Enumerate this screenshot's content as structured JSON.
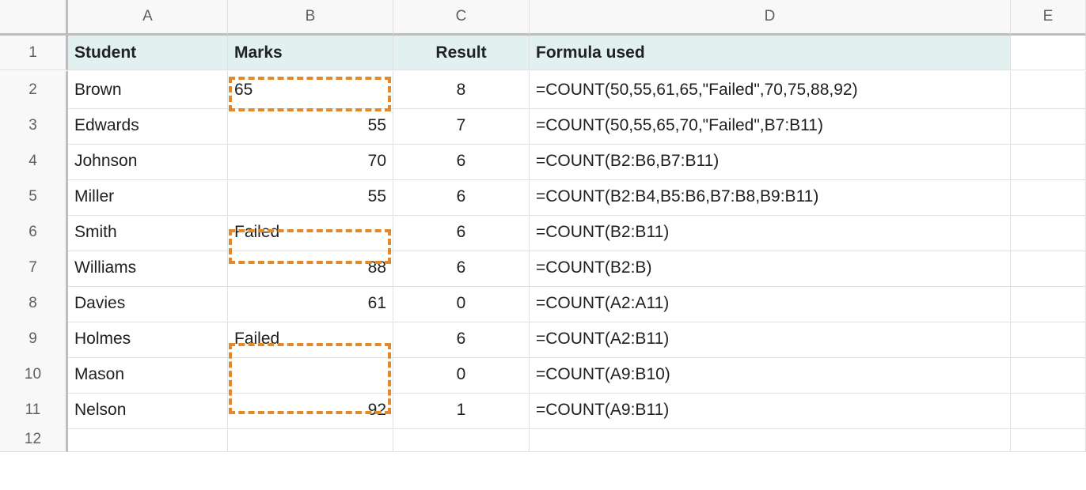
{
  "columns": [
    "A",
    "B",
    "C",
    "D",
    "E"
  ],
  "rows": [
    "1",
    "2",
    "3",
    "4",
    "5",
    "6",
    "7",
    "8",
    "9",
    "10",
    "11",
    "12"
  ],
  "headers": {
    "A": "Student",
    "B": "Marks",
    "C": "Result",
    "D": "Formula used"
  },
  "data": [
    {
      "student": "Brown",
      "marks": "65",
      "result": "8",
      "formula": "=COUNT(50,55,61,65,\"Failed\",70,75,88,92)"
    },
    {
      "student": "Edwards",
      "marks": "55",
      "result": "7",
      "formula": "=COUNT(50,55,65,70,\"Failed\",B7:B11)"
    },
    {
      "student": "Johnson",
      "marks": "70",
      "result": "6",
      "formula": "=COUNT(B2:B6,B7:B11)"
    },
    {
      "student": "Miller",
      "marks": "55",
      "result": "6",
      "formula": "=COUNT(B2:B4,B5:B6,B7:B8,B9:B11)"
    },
    {
      "student": "Smith",
      "marks": "Failed",
      "result": "6",
      "formula": "=COUNT(B2:B11)"
    },
    {
      "student": "Williams",
      "marks": "88",
      "result": "6",
      "formula": "=COUNT(B2:B)"
    },
    {
      "student": "Davies",
      "marks": "61",
      "result": "0",
      "formula": "=COUNT(A2:A11)"
    },
    {
      "student": "Holmes",
      "marks": "Failed",
      "result": "6",
      "formula": "=COUNT(A2:B11)"
    },
    {
      "student": "Mason",
      "marks": "",
      "result": "0",
      "formula": "=COUNT(A9:B10)"
    },
    {
      "student": "Nelson",
      "marks": "92",
      "result": "1",
      "formula": "=COUNT(A9:B11)"
    }
  ],
  "marks_align": [
    "left",
    "right",
    "right",
    "right",
    "left",
    "right",
    "right",
    "left",
    "left",
    "right"
  ]
}
